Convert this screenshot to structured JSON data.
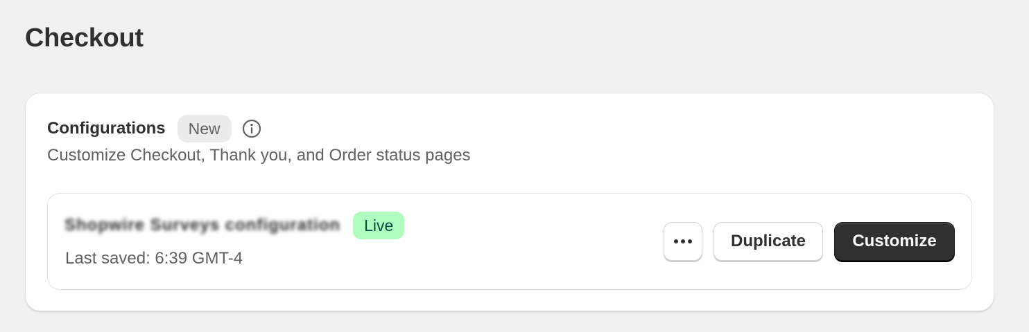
{
  "page": {
    "title": "Checkout"
  },
  "configurations": {
    "title": "Configurations",
    "badge": "New",
    "info_icon": "info-circle-icon",
    "subtitle": "Customize Checkout, Thank you, and Order status pages",
    "items": [
      {
        "name": "Shopwire Surveys configuration",
        "status": "Live",
        "last_saved": "Last saved: 6:39 GMT-4",
        "more_icon": "ellipsis-horizontal-icon",
        "duplicate_label": "Duplicate",
        "customize_label": "Customize"
      }
    ]
  },
  "colors": {
    "background": "#f1f1f1",
    "card": "#ffffff",
    "live_badge_bg": "#affebf",
    "live_badge_text": "#014b40",
    "new_badge_bg": "#ebebeb",
    "primary_button": "#303030"
  }
}
